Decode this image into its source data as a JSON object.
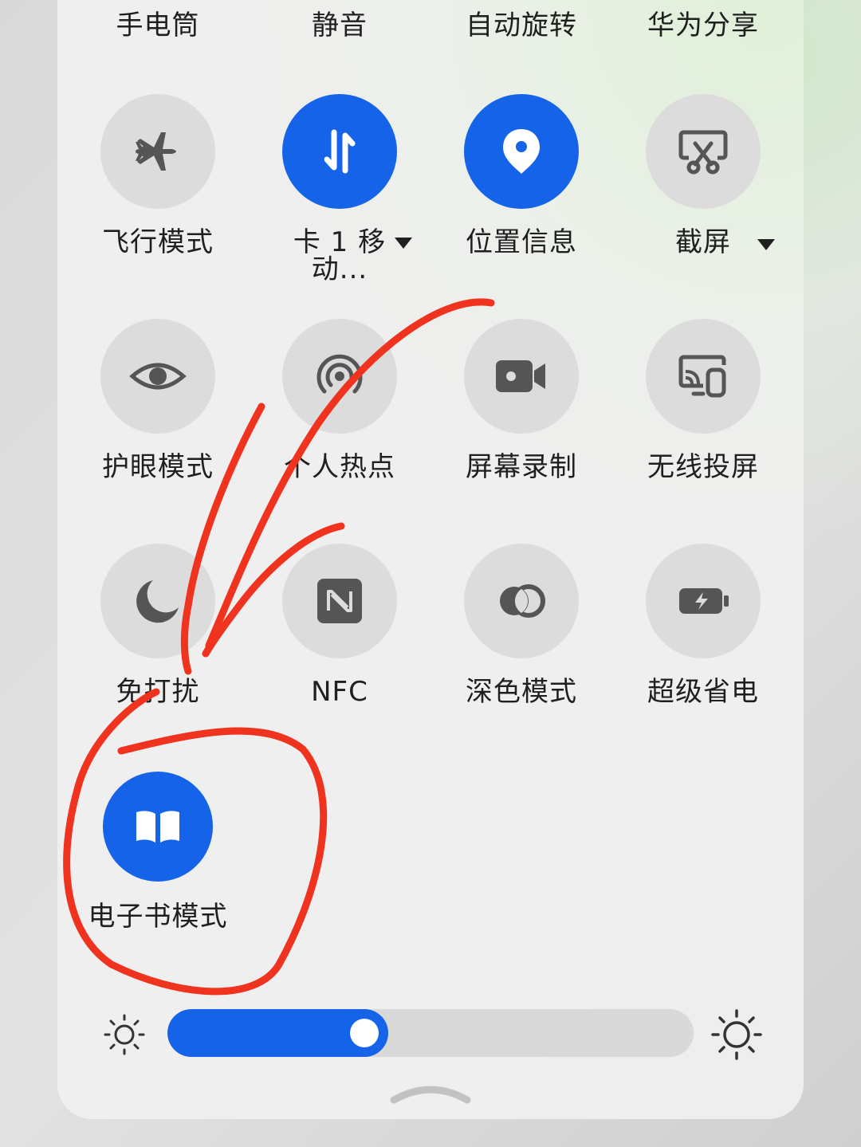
{
  "top_row": [
    "手电筒",
    "静音",
    "自动旋转",
    "华为分享"
  ],
  "tiles": [
    {
      "label": "飞行模式",
      "icon": "airplane-icon",
      "active": false
    },
    {
      "label": "卡 1 移动...",
      "label_line1": "卡 1 移",
      "label_line2": "动...",
      "icon": "mobile-data-icon",
      "active": true,
      "has_dropdown": true
    },
    {
      "label": "位置信息",
      "icon": "location-pin-icon",
      "active": true
    },
    {
      "label": "截屏",
      "icon": "screenshot-icon",
      "active": false,
      "has_dropdown": true
    },
    {
      "label": "护眼模式",
      "icon": "eye-icon",
      "active": false
    },
    {
      "label": "个人热点",
      "icon": "hotspot-icon",
      "active": false
    },
    {
      "label": "屏幕录制",
      "icon": "screen-record-icon",
      "active": false
    },
    {
      "label": "无线投屏",
      "icon": "wireless-projection-icon",
      "active": false
    },
    {
      "label": "免打扰",
      "icon": "moon-icon",
      "active": false
    },
    {
      "label": "NFC",
      "icon": "nfc-icon",
      "active": false
    },
    {
      "label": "深色模式",
      "icon": "dark-mode-icon",
      "active": false
    },
    {
      "label": "超级省电",
      "icon": "battery-saver-icon",
      "active": false
    },
    {
      "label": "电子书模式",
      "icon": "book-icon",
      "active": true
    }
  ],
  "brightness": {
    "level": 0.42,
    "min_icon": "brightness-low-icon",
    "max_icon": "brightness-high-icon"
  },
  "colors": {
    "accent": "#1463e8",
    "tile_off": "#dcdcdc",
    "icon_off": "#555555",
    "annotation": "#f0331e"
  }
}
